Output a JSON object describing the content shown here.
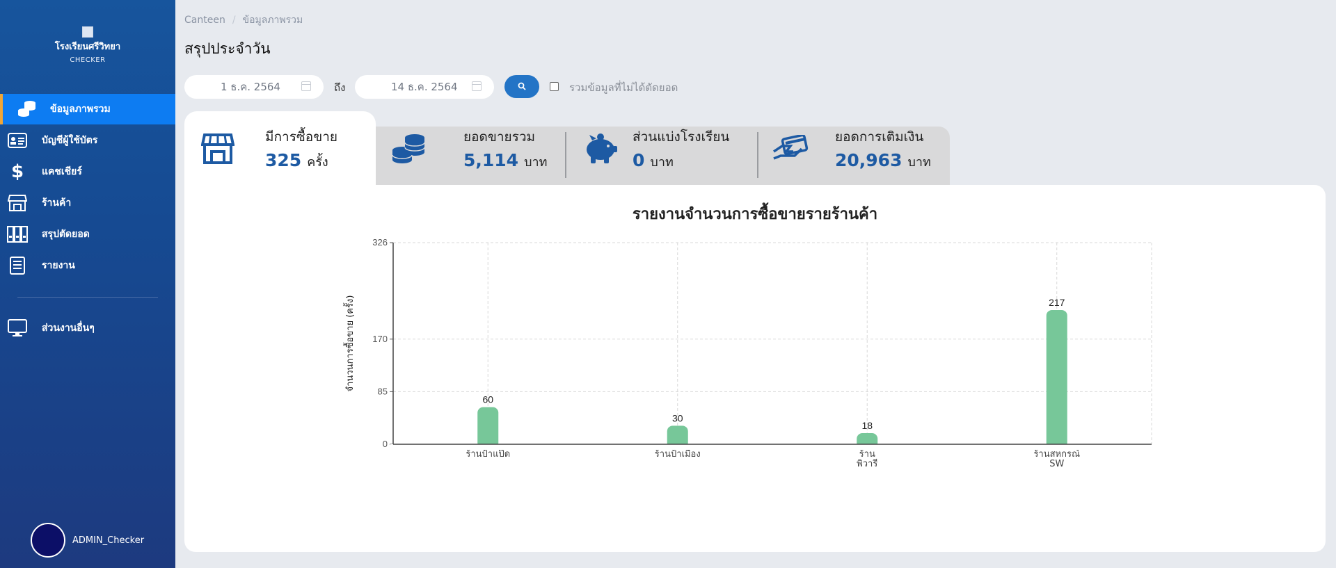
{
  "sidebar": {
    "school_name": "โรงเรียนศรีวิทยา",
    "brand": "CHECKER",
    "items": [
      {
        "label": "ข้อมูลภาพรวม",
        "icon": "coins-icon",
        "active": true
      },
      {
        "label": "บัญชีผู้ใช้บัตร",
        "icon": "id-card-icon",
        "active": false
      },
      {
        "label": "แคชเชียร์",
        "icon": "dollar-icon",
        "active": false
      },
      {
        "label": "ร้านค้า",
        "icon": "store-icon",
        "active": false
      },
      {
        "label": "สรุปตัดยอด",
        "icon": "binders-icon",
        "active": false
      },
      {
        "label": "รายงาน",
        "icon": "report-icon",
        "active": false
      }
    ],
    "other": {
      "label": "ส่วนงานอื่นๆ",
      "icon": "monitor-icon"
    },
    "user": {
      "name": "ADMIN_Checker"
    }
  },
  "breadcrumb": {
    "root": "Canteen",
    "current": "ข้อมูลภาพรวม"
  },
  "page_title": "สรุปประจำวัน",
  "filters": {
    "date_from": "1 ธ.ค. 2564",
    "to_label": "ถึง",
    "date_to": "14 ธ.ค. 2564",
    "include_label": "รวมข้อมูลที่ไม่ได้ตัดยอด",
    "include_checked": false
  },
  "stats": [
    {
      "label": "มีการซื้อขาย",
      "value": "325",
      "unit": "ครั้ง",
      "icon": "store-icon"
    },
    {
      "label": "ยอดขายรวม",
      "value": "5,114",
      "unit": "บาท",
      "icon": "coins-icon"
    },
    {
      "label": "ส่วนแบ่งโรงเรียน",
      "value": "0",
      "unit": "บาท",
      "icon": "piggy-bank-icon"
    },
    {
      "label": "ยอดการเติมเงิน",
      "value": "20,963",
      "unit": "บาท",
      "icon": "card-hand-icon"
    }
  ],
  "chart_data": {
    "type": "bar",
    "title": "รายงานจำนวนการซื้อขายรายร้านค้า",
    "ylabel": "จำนวนการซื้อขาย (ครั้ง)",
    "xlabel": "",
    "categories": [
      [
        "ร้านป้าแป๊ด"
      ],
      [
        "ร้านป้าเมือง"
      ],
      [
        "ร้าน",
        "พิวารี"
      ],
      [
        "ร้านสหกรณ์",
        "SW"
      ]
    ],
    "values": [
      60,
      30,
      18,
      217
    ],
    "ylim": [
      0,
      326
    ],
    "yticks": [
      0,
      85,
      170,
      326
    ],
    "grid": true,
    "bar_color": "#77c799"
  }
}
